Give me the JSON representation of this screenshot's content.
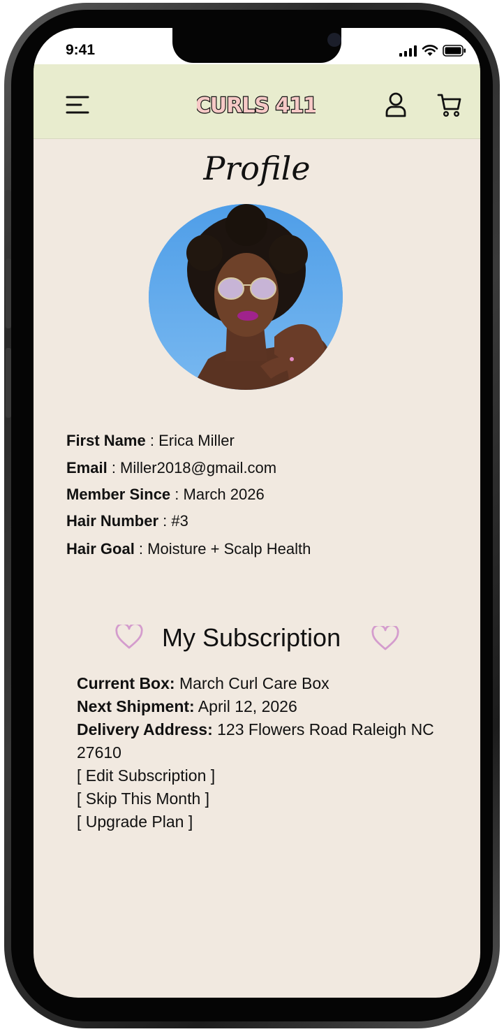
{
  "status_bar": {
    "time": "9:41"
  },
  "header": {
    "brand": "CURLS 411",
    "colors": {
      "header_bg": "#e8ecce",
      "logo_fill": "#f6c9c6",
      "logo_outline": "#111111"
    }
  },
  "page": {
    "title": "Profile",
    "background": "#f1e9e0"
  },
  "profile": {
    "fields": [
      {
        "label": "First Name",
        "sep": " : ",
        "value": "Erica Miller"
      },
      {
        "label": "Email",
        "sep": " : ",
        "value": "Miller2018@gmail.com"
      },
      {
        "label": "Member Since",
        "sep": " : ",
        "value": "March 2026"
      },
      {
        "label": "Hair Number",
        "sep": " : ",
        "value": "#3"
      },
      {
        "label": "Hair Goal",
        "sep": " : ",
        "value": "Moisture + Scalp Health"
      }
    ]
  },
  "subscription": {
    "heading": "My Subscription",
    "heart_color": "#d49ccd",
    "current_box_label": "Current Box:",
    "current_box_value": " March Curl Care Box",
    "next_shipment_label": "Next Shipment:",
    "next_shipment_value": " April 12, 2026",
    "delivery_label": "Delivery Address:",
    "delivery_value": " 123 Flowers Road Raleigh NC 27610",
    "actions": [
      "[ Edit Subscription ]",
      "[ Skip This Month ]",
      "[ Upgrade Plan ]"
    ]
  }
}
